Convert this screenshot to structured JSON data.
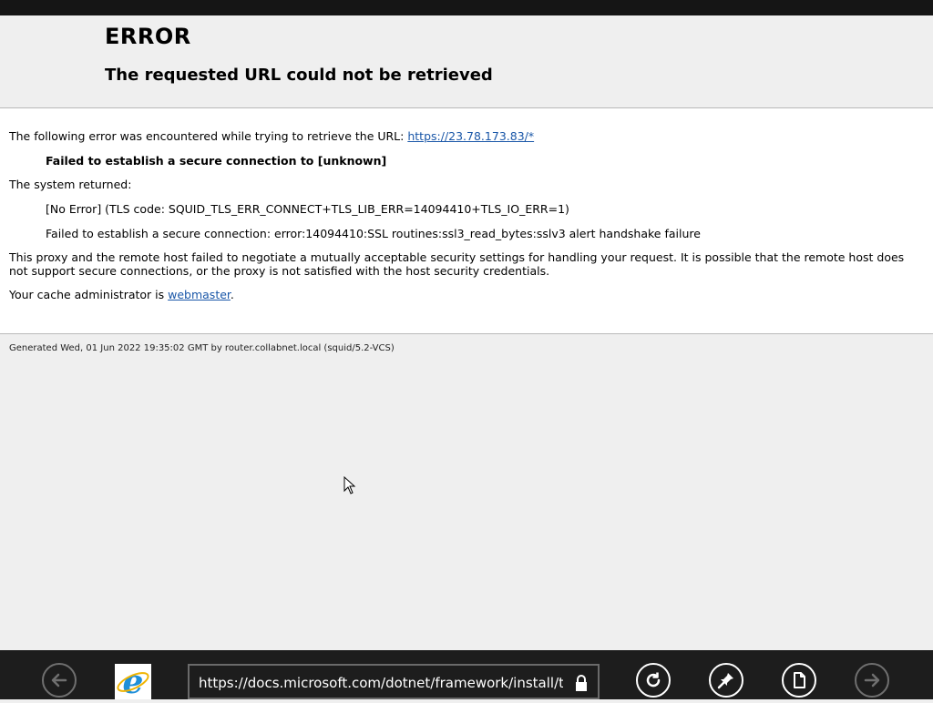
{
  "error_page": {
    "title": "ERROR",
    "subtitle": "The requested URL could not be retrieved",
    "intro_text": "The following error was encountered while trying to retrieve the URL: ",
    "url_link": "https://23.78.173.83/*",
    "failure_heading": "Failed to establish a secure connection to [unknown]",
    "system_returned_label": "The system returned:",
    "tls_code_line": "[No Error] (TLS code: SQUID_TLS_ERR_CONNECT+TLS_LIB_ERR=14094410+TLS_IO_ERR=1)",
    "ssl_error_line": "Failed to establish a secure connection: error:14094410:SSL routines:ssl3_read_bytes:sslv3 alert handshake failure",
    "explanation": "This proxy and the remote host failed to negotiate a mutually acceptable security settings for handling your request. It is possible that the remote host does not support secure connections, or the proxy is not satisfied with the host security credentials.",
    "admin_text": "Your cache administrator is ",
    "admin_link": "webmaster",
    "admin_suffix": ".",
    "generated_footer": "Generated Wed, 01 Jun 2022 19:35:02 GMT by router.collabnet.local (squid/5.2-VCS)"
  },
  "browser_bar": {
    "address_url": "https://docs.microsoft.com/dotnet/framework/install/troubleshoot",
    "icons": {
      "back": "arrow-left-icon",
      "logo": "internet-explorer-logo",
      "lock": "lock-icon",
      "refresh": "refresh-icon",
      "pin": "pin-icon",
      "page_tools": "page-icon",
      "forward": "arrow-right-icon"
    }
  },
  "colors": {
    "link": "#1a57a8",
    "page_background": "#efefef",
    "app_bar": "#1d1d1d",
    "ie_blue": "#1e8fd9"
  }
}
